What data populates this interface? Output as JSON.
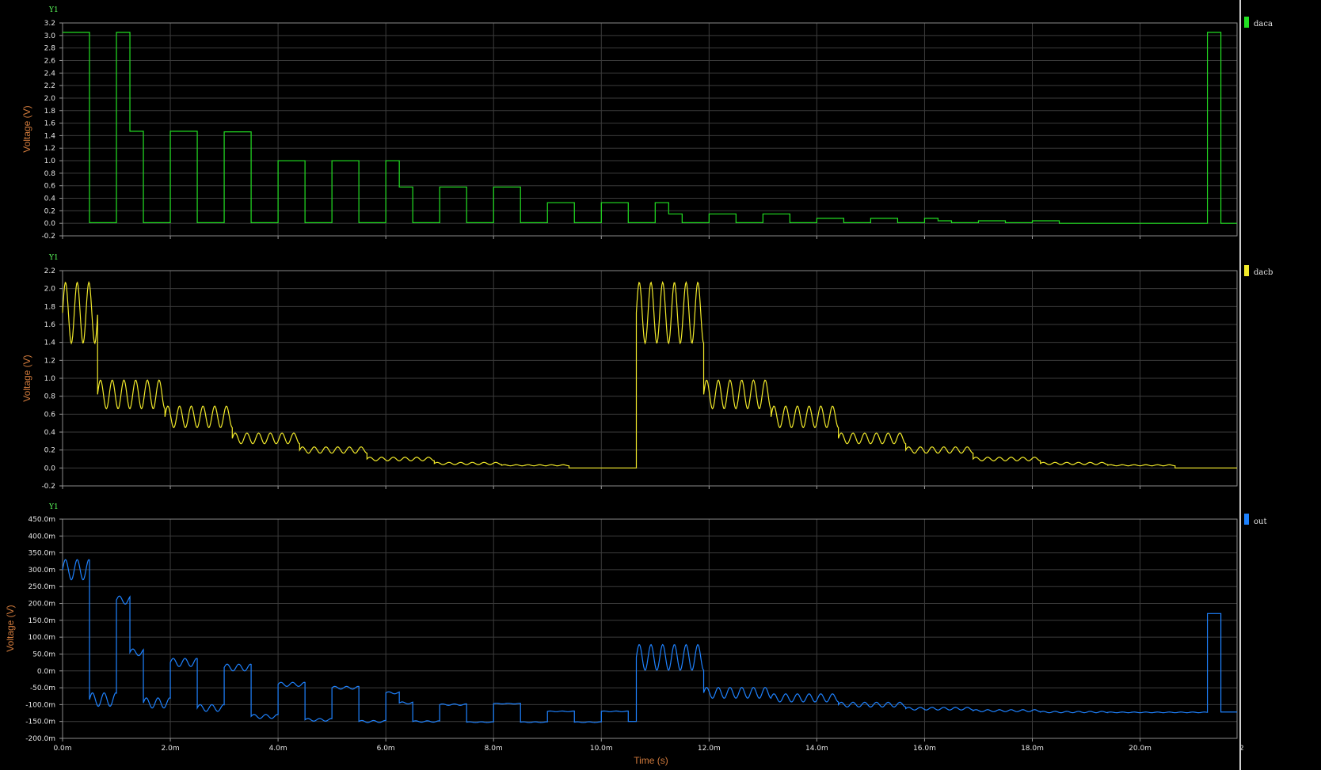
{
  "x_axis": {
    "label": "Time (s)",
    "ticks": [
      "0.0m",
      "2.0m",
      "4.0m",
      "6.0m",
      "8.0m",
      "10.0m",
      "12.0m",
      "14.0m",
      "16.0m",
      "18.0m",
      "20.0m",
      "2"
    ],
    "tick_values": [
      0,
      2,
      4,
      6,
      8,
      10,
      12,
      14,
      16,
      18,
      20,
      22
    ],
    "range": [
      0,
      21.8
    ]
  },
  "chart_data": [
    {
      "type": "line",
      "axis_tag": "Y1",
      "ylabel": "Voltage (V)",
      "ylim": [
        -0.2,
        3.2
      ],
      "yticks": [
        "-0.2",
        "0.0",
        "0.2",
        "0.4",
        "0.6",
        "0.8",
        "1.0",
        "1.2",
        "1.4",
        "1.6",
        "1.8",
        "2.0",
        "2.2",
        "2.4",
        "2.6",
        "2.8",
        "3.0",
        "3.2"
      ],
      "ytick_values": [
        -0.2,
        0,
        0.2,
        0.4,
        0.6,
        0.8,
        1.0,
        1.2,
        1.4,
        1.6,
        1.8,
        2.0,
        2.2,
        2.4,
        2.6,
        2.8,
        3.0,
        3.2
      ],
      "color": "#22e022",
      "series": [
        {
          "name": "daca",
          "style": "step",
          "x": [
            0,
            0.5,
            0.5,
            1.0,
            1.0,
            1.25,
            1.25,
            1.5,
            1.5,
            2.0,
            2.0,
            2.5,
            2.5,
            3.0,
            3.0,
            3.5,
            3.5,
            4.0,
            4.0,
            4.5,
            4.5,
            5.0,
            5.0,
            5.5,
            5.5,
            6.0,
            6.0,
            6.25,
            6.25,
            6.5,
            6.5,
            7.0,
            7.0,
            7.5,
            7.5,
            8.0,
            8.0,
            8.5,
            8.5,
            9.0,
            9.0,
            9.5,
            9.5,
            10.0,
            10.0,
            10.5,
            10.5,
            11.0,
            11.0,
            11.25,
            11.25,
            11.5,
            11.5,
            12.0,
            12.0,
            12.5,
            12.5,
            13.0,
            13.0,
            13.5,
            13.5,
            14.0,
            14.0,
            14.5,
            14.5,
            15.0,
            15.0,
            15.5,
            15.5,
            16.0,
            16.0,
            16.25,
            16.25,
            16.5,
            16.5,
            17.0,
            17.0,
            17.5,
            17.5,
            18.0,
            18.0,
            18.5,
            18.5,
            21.25,
            21.25,
            21.5,
            21.5,
            21.8
          ],
          "y": [
            3.05,
            3.05,
            0.01,
            0.01,
            3.05,
            3.05,
            1.47,
            1.47,
            0.01,
            0.01,
            1.47,
            1.47,
            0.01,
            0.01,
            1.46,
            1.46,
            0.01,
            0.01,
            1.0,
            1.0,
            0.01,
            0.01,
            1.0,
            1.0,
            0.01,
            0.01,
            1.0,
            1.0,
            0.58,
            0.58,
            0.01,
            0.01,
            0.58,
            0.58,
            0.01,
            0.01,
            0.58,
            0.58,
            0.01,
            0.01,
            0.33,
            0.33,
            0.01,
            0.01,
            0.33,
            0.33,
            0.01,
            0.01,
            0.33,
            0.33,
            0.15,
            0.15,
            0.01,
            0.01,
            0.15,
            0.15,
            0.01,
            0.01,
            0.15,
            0.15,
            0.01,
            0.01,
            0.08,
            0.08,
            0.01,
            0.01,
            0.08,
            0.08,
            0.01,
            0.01,
            0.08,
            0.08,
            0.04,
            0.04,
            0.01,
            0.01,
            0.04,
            0.04,
            0.01,
            0.01,
            0.04,
            0.04,
            0.0,
            0.0,
            3.05,
            3.05,
            0.0,
            0.0
          ]
        }
      ]
    },
    {
      "type": "line",
      "axis_tag": "Y1",
      "ylabel": "Voltage (V)",
      "ylim": [
        -0.2,
        2.2
      ],
      "yticks": [
        "-0.2",
        "0.0",
        "0.2",
        "0.4",
        "0.6",
        "0.8",
        "1.0",
        "1.2",
        "1.4",
        "1.6",
        "1.8",
        "2.0",
        "2.2"
      ],
      "ytick_values": [
        -0.2,
        0,
        0.2,
        0.4,
        0.6,
        0.8,
        1.0,
        1.2,
        1.4,
        1.6,
        1.8,
        2.0,
        2.2
      ],
      "color": "#f2ea2a",
      "series": [
        {
          "name": "dacb",
          "style": "ripple",
          "ripple_cycles_per_ms": 4.6,
          "segments": [
            {
              "x0": 0.0,
              "x1": 0.65,
              "level": 1.73,
              "amp": 0.34
            },
            {
              "x0": 0.65,
              "x1": 1.9,
              "level": 0.82,
              "amp": 0.16
            },
            {
              "x0": 1.9,
              "x1": 3.15,
              "level": 0.57,
              "amp": 0.12
            },
            {
              "x0": 3.15,
              "x1": 4.4,
              "level": 0.33,
              "amp": 0.06
            },
            {
              "x0": 4.4,
              "x1": 5.65,
              "level": 0.2,
              "amp": 0.035
            },
            {
              "x0": 5.65,
              "x1": 6.9,
              "level": 0.1,
              "amp": 0.02
            },
            {
              "x0": 6.9,
              "x1": 8.15,
              "level": 0.05,
              "amp": 0.012
            },
            {
              "x0": 8.15,
              "x1": 9.4,
              "level": 0.03,
              "amp": 0.006
            },
            {
              "x0": 9.4,
              "x1": 10.65,
              "level": 0.0,
              "amp": 0.0
            },
            {
              "x0": 10.65,
              "x1": 11.9,
              "level": 1.73,
              "amp": 0.34
            },
            {
              "x0": 11.9,
              "x1": 13.15,
              "level": 0.82,
              "amp": 0.16
            },
            {
              "x0": 13.15,
              "x1": 14.4,
              "level": 0.57,
              "amp": 0.12
            },
            {
              "x0": 14.4,
              "x1": 15.65,
              "level": 0.33,
              "amp": 0.06
            },
            {
              "x0": 15.65,
              "x1": 16.9,
              "level": 0.2,
              "amp": 0.035
            },
            {
              "x0": 16.9,
              "x1": 18.15,
              "level": 0.1,
              "amp": 0.02
            },
            {
              "x0": 18.15,
              "x1": 19.4,
              "level": 0.05,
              "amp": 0.012
            },
            {
              "x0": 19.4,
              "x1": 20.65,
              "level": 0.03,
              "amp": 0.006
            },
            {
              "x0": 20.65,
              "x1": 21.8,
              "level": 0.0,
              "amp": 0.0
            }
          ]
        }
      ]
    },
    {
      "type": "line",
      "axis_tag": "Y1",
      "ylabel": "Voltage (V)",
      "ylim": [
        -200,
        450
      ],
      "yticks": [
        "-200.0m",
        "-150.0m",
        "-100.0m",
        "-50.0m",
        "0.0m",
        "50.0m",
        "100.0m",
        "150.0m",
        "200.0m",
        "250.0m",
        "300.0m",
        "350.0m",
        "400.0m",
        "450.0m"
      ],
      "ytick_values": [
        -200,
        -150,
        -100,
        -50,
        0,
        50,
        100,
        150,
        200,
        250,
        300,
        350,
        400,
        450
      ],
      "y_units": "mV",
      "color": "#1e82ff",
      "series": [
        {
          "name": "out",
          "style": "ripple",
          "ripple_cycles_per_ms": 4.6,
          "segments": [
            {
              "x0": 0.0,
              "x1": 0.5,
              "level": 300,
              "amp": 30
            },
            {
              "x0": 0.5,
              "x1": 1.0,
              "level": -85,
              "amp": 20
            },
            {
              "x0": 1.0,
              "x1": 1.25,
              "level": 210,
              "amp": 12
            },
            {
              "x0": 1.25,
              "x1": 1.5,
              "level": 55,
              "amp": 10
            },
            {
              "x0": 1.5,
              "x1": 2.0,
              "level": -95,
              "amp": 15
            },
            {
              "x0": 2.0,
              "x1": 2.5,
              "level": 25,
              "amp": 12
            },
            {
              "x0": 2.5,
              "x1": 3.0,
              "level": -110,
              "amp": 10
            },
            {
              "x0": 3.0,
              "x1": 3.5,
              "level": 10,
              "amp": 10
            },
            {
              "x0": 3.5,
              "x1": 4.0,
              "level": -135,
              "amp": 6
            },
            {
              "x0": 4.0,
              "x1": 4.5,
              "level": -40,
              "amp": 6
            },
            {
              "x0": 4.5,
              "x1": 5.0,
              "level": -145,
              "amp": 4
            },
            {
              "x0": 5.0,
              "x1": 5.5,
              "level": -50,
              "amp": 4
            },
            {
              "x0": 5.5,
              "x1": 6.0,
              "level": -150,
              "amp": 3
            },
            {
              "x0": 6.0,
              "x1": 6.25,
              "level": -65,
              "amp": 3
            },
            {
              "x0": 6.25,
              "x1": 6.5,
              "level": -95,
              "amp": 3
            },
            {
              "x0": 6.5,
              "x1": 7.0,
              "level": -150,
              "amp": 2
            },
            {
              "x0": 7.0,
              "x1": 7.5,
              "level": -100,
              "amp": 2
            },
            {
              "x0": 7.5,
              "x1": 8.0,
              "level": -152,
              "amp": 1
            },
            {
              "x0": 8.0,
              "x1": 8.5,
              "level": -97,
              "amp": 1
            },
            {
              "x0": 8.5,
              "x1": 9.0,
              "level": -152,
              "amp": 1
            },
            {
              "x0": 9.0,
              "x1": 9.5,
              "level": -120,
              "amp": 1
            },
            {
              "x0": 9.5,
              "x1": 10.0,
              "level": -152,
              "amp": 1
            },
            {
              "x0": 10.0,
              "x1": 10.5,
              "level": -120,
              "amp": 1
            },
            {
              "x0": 10.5,
              "x1": 10.65,
              "level": -150,
              "amp": 0
            },
            {
              "x0": 10.65,
              "x1": 11.9,
              "level": 40,
              "amp": 38
            },
            {
              "x0": 11.9,
              "x1": 13.15,
              "level": -65,
              "amp": 16
            },
            {
              "x0": 13.15,
              "x1": 14.4,
              "level": -80,
              "amp": 12
            },
            {
              "x0": 14.4,
              "x1": 15.65,
              "level": -100,
              "amp": 7
            },
            {
              "x0": 15.65,
              "x1": 16.9,
              "level": -112,
              "amp": 4
            },
            {
              "x0": 16.9,
              "x1": 18.15,
              "level": -118,
              "amp": 3
            },
            {
              "x0": 18.15,
              "x1": 19.4,
              "level": -122,
              "amp": 2
            },
            {
              "x0": 19.4,
              "x1": 21.25,
              "level": -123,
              "amp": 1
            },
            {
              "x0": 21.25,
              "x1": 21.5,
              "level": 170,
              "amp": 0
            },
            {
              "x0": 21.5,
              "x1": 21.8,
              "level": -122,
              "amp": 0
            }
          ]
        }
      ]
    }
  ]
}
